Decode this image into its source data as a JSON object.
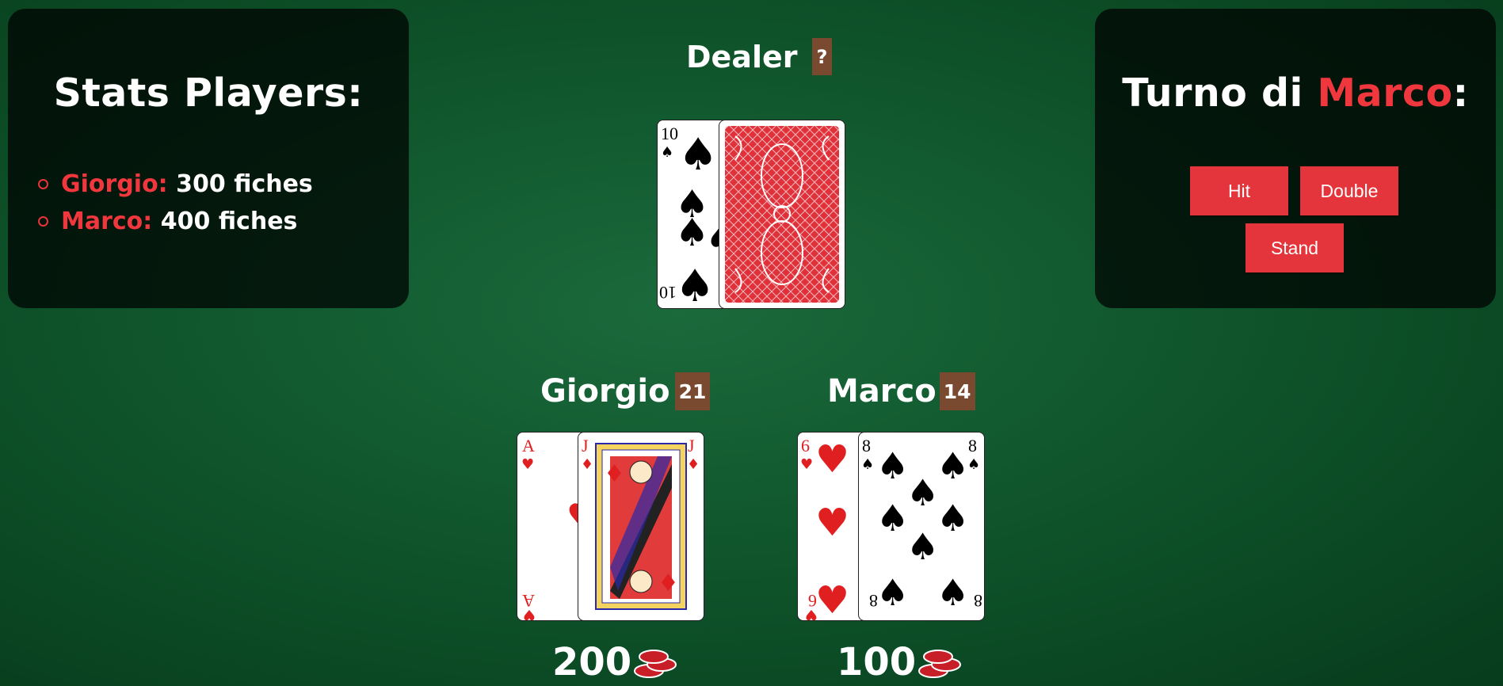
{
  "stats_panel": {
    "title": "Stats Players:",
    "players": [
      {
        "name": "Giorgio:",
        "fiches": "300 fiches"
      },
      {
        "name": "Marco:",
        "fiches": "400 fiches"
      }
    ]
  },
  "turn_panel": {
    "title_prefix": "Turno di ",
    "player": "Marco",
    "title_suffix": ":",
    "buttons": {
      "hit": "Hit",
      "double": "Double",
      "stand": "Stand"
    }
  },
  "dealer": {
    "label": "Dealer",
    "score": "?",
    "cards": [
      {
        "rank": "10",
        "suit": "spades"
      },
      {
        "face_down": true
      }
    ]
  },
  "players": [
    {
      "name": "Giorgio",
      "score": "21",
      "bet": "200",
      "cards": [
        {
          "rank": "A",
          "suit": "hearts"
        },
        {
          "rank": "J",
          "suit": "diamonds"
        }
      ]
    },
    {
      "name": "Marco",
      "score": "14",
      "bet": "100",
      "cards": [
        {
          "rank": "6",
          "suit": "hearts"
        },
        {
          "rank": "8",
          "suit": "spades"
        }
      ]
    }
  ],
  "colors": {
    "accent": "#e3353b",
    "badge": "#7a4a30",
    "table": "#125a30"
  }
}
